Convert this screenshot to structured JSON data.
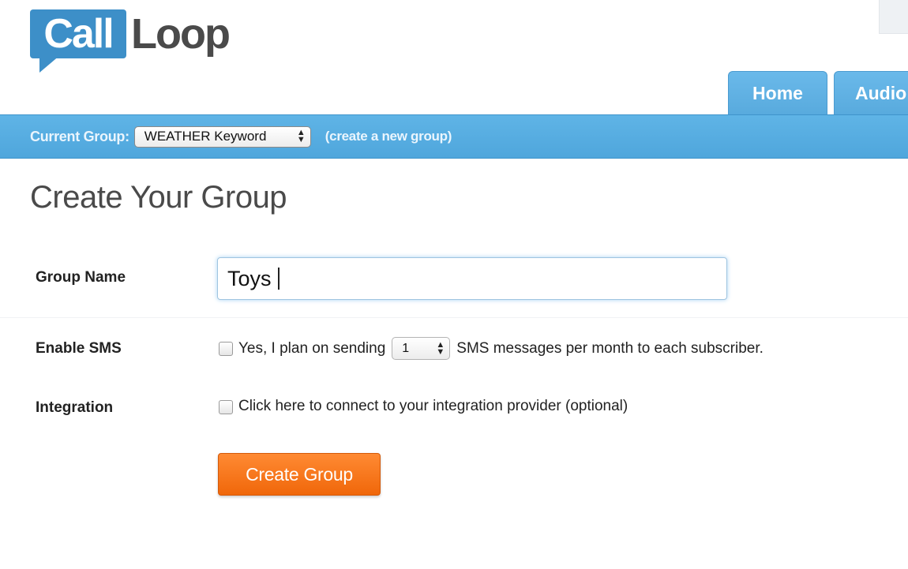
{
  "logo": {
    "part1": "Call",
    "part2": "Loop"
  },
  "nav": {
    "tabs": [
      {
        "label": "Home"
      },
      {
        "label": "Audio"
      }
    ]
  },
  "group_bar": {
    "current_label": "Current Group:",
    "selected_group": "WEATHER Keyword",
    "create_link": "(create a new group)"
  },
  "page": {
    "title": "Create Your Group"
  },
  "form": {
    "group_name_label": "Group Name",
    "group_name_value": "Toys",
    "enable_sms_label": "Enable SMS",
    "sms_prefix": "Yes, I plan on sending",
    "sms_count": "1",
    "sms_suffix": "SMS messages per month to each subscriber.",
    "integration_label": "Integration",
    "integration_text": "Click here to connect to your integration provider (optional)",
    "submit_label": "Create Group"
  },
  "colors": {
    "brand_blue": "#3d8fc8",
    "bar_blue": "#55aae0",
    "button_orange": "#f57a1f"
  }
}
